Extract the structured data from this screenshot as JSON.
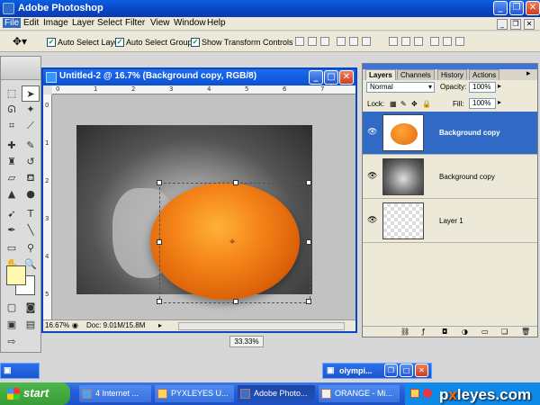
{
  "app": {
    "title": "Adobe Photoshop"
  },
  "menu": [
    "File",
    "Edit",
    "Image",
    "Layer",
    "Select",
    "Filter",
    "View",
    "Window",
    "Help"
  ],
  "options": {
    "auto_select_layer": "Auto Select Layer",
    "auto_select_groups": "Auto Select Groups",
    "show_transform_controls": "Show Transform Controls"
  },
  "document": {
    "title": "Untitled-2 @ 16.7% (Background copy, RGB/8)",
    "zoom": "16.67%",
    "doc_info": "Doc: 9.01M/15.8M",
    "ruler_ticks": [
      "0",
      "1",
      "2",
      "3",
      "4",
      "5",
      "6",
      "7"
    ]
  },
  "zoom_readout": "33.33%",
  "layers_panel": {
    "tabs": [
      "Layers",
      "Channels",
      "History",
      "Actions"
    ],
    "blend_mode": "Normal",
    "opacity_label": "Opacity:",
    "opacity": "100%",
    "lock_label": "Lock:",
    "fill_label": "Fill:",
    "fill": "100%",
    "layers": [
      {
        "name": "Background copy",
        "selected": true
      },
      {
        "name": "Background copy",
        "selected": false
      },
      {
        "name": "Layer 1",
        "selected": false
      }
    ]
  },
  "minimized": {
    "olympics": "olympi..."
  },
  "taskbar": {
    "start": "start",
    "tasks": [
      "4 Internet ...",
      "PYXLEYES U...",
      "Adobe Photo...",
      "ORANGE - Mi..."
    ]
  },
  "watermark": {
    "prefix": "p",
    "x": "x",
    "suffix": "leyes.com"
  },
  "colors": {
    "foreground": "#fff9b0",
    "background": "#ffffff",
    "selection": "#316ac5",
    "titlebar": "#0a48c8"
  }
}
